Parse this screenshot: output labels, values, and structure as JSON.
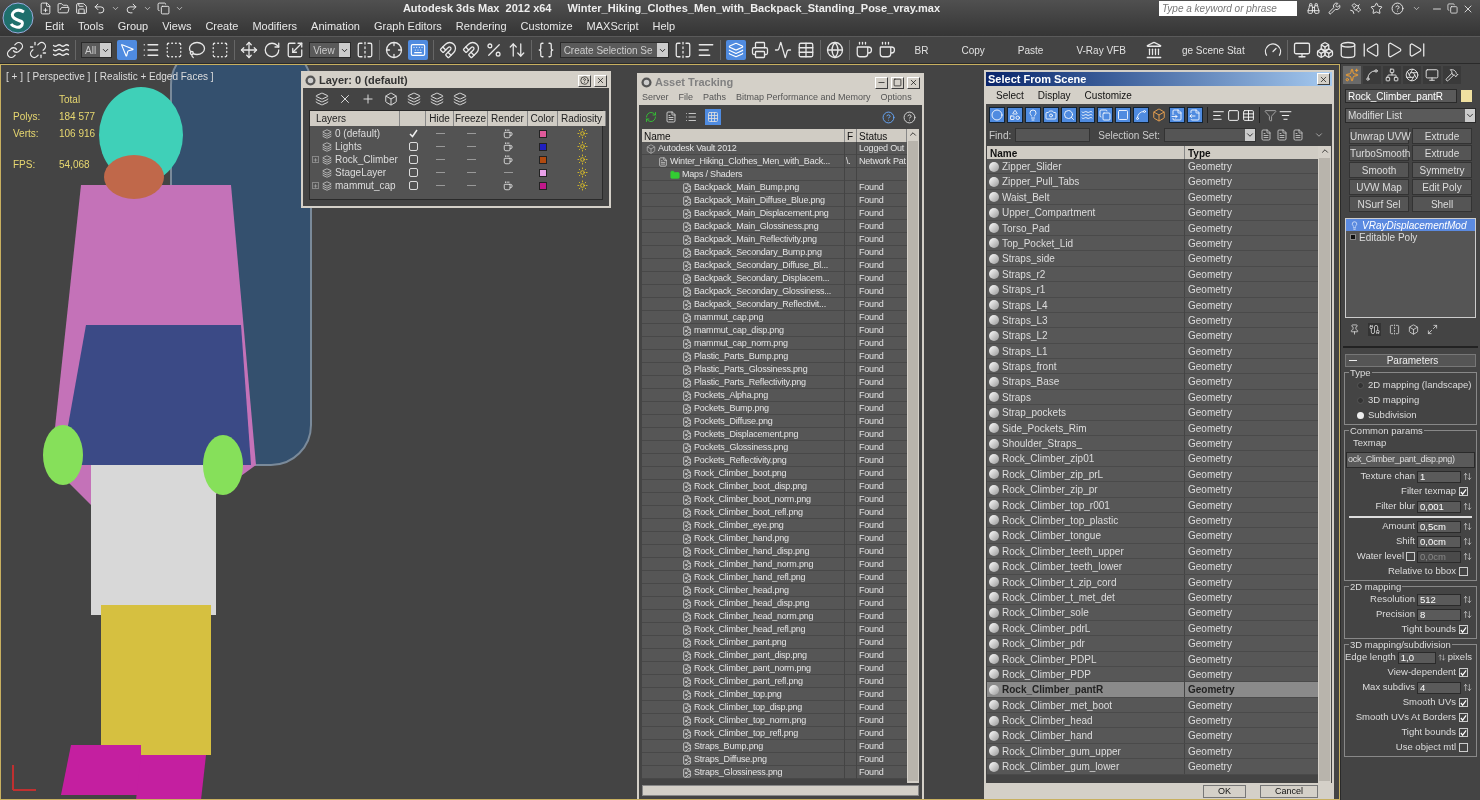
{
  "title_bar": {
    "app": "Autodesk 3ds Max  2012 x64",
    "file": "Winter_Hiking_Clothes_Men_with_Backpack_Standing_Pose_vray.max",
    "search_placeholder": "Type a keyword or phrase"
  },
  "menu": [
    "Edit",
    "Tools",
    "Group",
    "Views",
    "Create",
    "Modifiers",
    "Animation",
    "Graph Editors",
    "Rendering",
    "Customize",
    "MAXScript",
    "Help"
  ],
  "main_toolbar": [
    {
      "kind": "icon",
      "selected": false
    },
    {
      "kind": "icon",
      "selected": false
    },
    {
      "kind": "icon",
      "selected": false
    },
    {
      "kind": "separator"
    },
    {
      "kind": "dropdown",
      "value": "All"
    },
    {
      "kind": "icon",
      "selected": true
    },
    {
      "kind": "icon",
      "selected": false
    },
    {
      "kind": "icon",
      "selected": false
    },
    {
      "kind": "icon",
      "selected": false
    },
    {
      "kind": "icon",
      "selected": false
    },
    {
      "kind": "separator"
    },
    {
      "kind": "icon",
      "selected": false
    },
    {
      "kind": "icon",
      "selected": false
    },
    {
      "kind": "icon",
      "selected": false
    },
    {
      "kind": "dropdown",
      "value": "View"
    },
    {
      "kind": "icon",
      "selected": false
    },
    {
      "kind": "separator"
    },
    {
      "kind": "icon",
      "selected": false
    },
    {
      "kind": "icon",
      "selected": true
    },
    {
      "kind": "separator"
    },
    {
      "kind": "icon",
      "selected": false
    },
    {
      "kind": "icon",
      "selected": false
    },
    {
      "kind": "icon",
      "selected": false
    },
    {
      "kind": "icon",
      "selected": false
    },
    {
      "kind": "separator"
    },
    {
      "kind": "icon",
      "selected": false
    },
    {
      "kind": "dropdown",
      "value": "Create Selection Se"
    },
    {
      "kind": "icon",
      "selected": false
    },
    {
      "kind": "icon",
      "selected": false
    },
    {
      "kind": "separator"
    },
    {
      "kind": "icon",
      "selected": true
    },
    {
      "kind": "icon",
      "selected": false
    },
    {
      "kind": "icon",
      "selected": false
    },
    {
      "kind": "icon",
      "selected": false
    },
    {
      "kind": "separator"
    },
    {
      "kind": "icon",
      "selected": false
    },
    {
      "kind": "separator"
    },
    {
      "kind": "icon",
      "selected": false
    },
    {
      "kind": "icon",
      "selected": false
    },
    {
      "kind": "text",
      "label": "BR"
    },
    {
      "kind": "text",
      "label": "Copy"
    },
    {
      "kind": "text",
      "label": "Paste"
    },
    {
      "kind": "text",
      "label": "V-Ray VFB"
    },
    {
      "kind": "icon",
      "selected": false
    },
    {
      "kind": "text",
      "label": "ge Scene Stat"
    },
    {
      "kind": "icon",
      "selected": false
    },
    {
      "kind": "separator"
    },
    {
      "kind": "icon",
      "selected": false
    },
    {
      "kind": "icon",
      "selected": false
    },
    {
      "kind": "icon",
      "selected": false
    },
    {
      "kind": "icon",
      "selected": false
    },
    {
      "kind": "icon",
      "selected": false
    },
    {
      "kind": "icon",
      "selected": false
    }
  ],
  "viewport": {
    "labels": [
      "[ + ]",
      "[ Perspective ]",
      "[ Realistic + Edged Faces ]"
    ],
    "stats": {
      "heading": "Total",
      "rows": [
        {
          "label": "Polys:",
          "value": "184 577"
        },
        {
          "label": "Verts:",
          "value": "106 916"
        },
        {
          "label": "FPS:",
          "value": "54,068"
        }
      ]
    }
  },
  "layer_window": {
    "title": "Layer: 0 (default)",
    "columns": [
      "Layers",
      "Hide",
      "Freeze",
      "Render",
      "Color",
      "Radiosity"
    ],
    "layers": [
      {
        "name": "0 (default)",
        "current": true,
        "expandable": false,
        "render": true,
        "color": "#e05a9a"
      },
      {
        "name": "Lights",
        "current": false,
        "expandable": false,
        "render": true,
        "color": "#2020c0"
      },
      {
        "name": "Rock_Climber",
        "current": false,
        "expandable": true,
        "render": true,
        "color": "#b04a10"
      },
      {
        "name": "StageLayer",
        "current": false,
        "expandable": false,
        "render": false,
        "color": "#e8a0e8"
      },
      {
        "name": "mammut_cap",
        "current": false,
        "expandable": true,
        "render": true,
        "color": "#c0188a"
      }
    ]
  },
  "asset_tracking": {
    "title": "Asset Tracking",
    "menu": [
      "Server",
      "File",
      "Paths",
      "Bitmap Performance and Memory",
      "Options"
    ],
    "columns": [
      "Name",
      "F",
      "Status"
    ],
    "tree": [
      {
        "kind": "vault",
        "name": "Autodesk Vault 2012",
        "status": "Logged Out",
        "children": [
          {
            "kind": "scene-file",
            "name": "Winter_Hiking_Clothes_Men_with_Back...",
            "flag": "\\.",
            "status": "Network Pat",
            "children": [
              {
                "kind": "folder",
                "name": "Maps / Shaders",
                "children": [
                  {
                    "kind": "bitmap",
                    "name": "Backpack_Main_Bump.png",
                    "status": "Found"
                  },
                  {
                    "kind": "bitmap",
                    "name": "Backpack_Main_Diffuse_Blue.png",
                    "status": "Found"
                  },
                  {
                    "kind": "bitmap",
                    "name": "Backpack_Main_Displacement.png",
                    "status": "Found"
                  },
                  {
                    "kind": "bitmap",
                    "name": "Backpack_Main_Glossiness.png",
                    "status": "Found"
                  },
                  {
                    "kind": "bitmap",
                    "name": "Backpack_Main_Reflectivity.png",
                    "status": "Found"
                  },
                  {
                    "kind": "bitmap",
                    "name": "Backpack_Secondary_Bump.png",
                    "status": "Found"
                  },
                  {
                    "kind": "bitmap",
                    "name": "Backpack_Secondary_Diffuse_Bl...",
                    "status": "Found"
                  },
                  {
                    "kind": "bitmap",
                    "name": "Backpack_Secondary_Displacem...",
                    "status": "Found"
                  },
                  {
                    "kind": "bitmap",
                    "name": "Backpack_Secondary_Glossiness...",
                    "status": "Found"
                  },
                  {
                    "kind": "bitmap",
                    "name": "Backpack_Secondary_Reflectivit...",
                    "status": "Found"
                  },
                  {
                    "kind": "bitmap",
                    "name": "mammut_cap.png",
                    "status": "Found"
                  },
                  {
                    "kind": "bitmap",
                    "name": "mammut_cap_disp.png",
                    "status": "Found"
                  },
                  {
                    "kind": "bitmap",
                    "name": "mammut_cap_norm.png",
                    "status": "Found"
                  },
                  {
                    "kind": "bitmap",
                    "name": "Plastic_Parts_Bump.png",
                    "status": "Found"
                  },
                  {
                    "kind": "bitmap",
                    "name": "Plastic_Parts_Glossiness.png",
                    "status": "Found"
                  },
                  {
                    "kind": "bitmap",
                    "name": "Plastic_Parts_Reflectivity.png",
                    "status": "Found"
                  },
                  {
                    "kind": "bitmap",
                    "name": "Pockets_Alpha.png",
                    "status": "Found"
                  },
                  {
                    "kind": "bitmap",
                    "name": "Pockets_Bump.png",
                    "status": "Found"
                  },
                  {
                    "kind": "bitmap",
                    "name": "Pockets_Diffuse.png",
                    "status": "Found"
                  },
                  {
                    "kind": "bitmap",
                    "name": "Pockets_Displacement.png",
                    "status": "Found"
                  },
                  {
                    "kind": "bitmap",
                    "name": "Pockets_Glossiness.png",
                    "status": "Found"
                  },
                  {
                    "kind": "bitmap",
                    "name": "Pockets_Reflectivity.png",
                    "status": "Found"
                  },
                  {
                    "kind": "bitmap",
                    "name": "Rock_Climber_boot.png",
                    "status": "Found"
                  },
                  {
                    "kind": "bitmap",
                    "name": "Rock_Climber_boot_disp.png",
                    "status": "Found"
                  },
                  {
                    "kind": "bitmap",
                    "name": "Rock_Climber_boot_norm.png",
                    "status": "Found"
                  },
                  {
                    "kind": "bitmap",
                    "name": "Rock_Climber_boot_refl.png",
                    "status": "Found"
                  },
                  {
                    "kind": "bitmap",
                    "name": "Rock_Climber_eye.png",
                    "status": "Found"
                  },
                  {
                    "kind": "bitmap",
                    "name": "Rock_Climber_hand.png",
                    "status": "Found"
                  },
                  {
                    "kind": "bitmap",
                    "name": "Rock_Climber_hand_disp.png",
                    "status": "Found"
                  },
                  {
                    "kind": "bitmap",
                    "name": "Rock_Climber_hand_norm.png",
                    "status": "Found"
                  },
                  {
                    "kind": "bitmap",
                    "name": "Rock_Climber_hand_refl.png",
                    "status": "Found"
                  },
                  {
                    "kind": "bitmap",
                    "name": "Rock_Climber_head.png",
                    "status": "Found"
                  },
                  {
                    "kind": "bitmap",
                    "name": "Rock_Climber_head_disp.png",
                    "status": "Found"
                  },
                  {
                    "kind": "bitmap",
                    "name": "Rock_Climber_head_norm.png",
                    "status": "Found"
                  },
                  {
                    "kind": "bitmap",
                    "name": "Rock_Climber_head_refl.png",
                    "status": "Found"
                  },
                  {
                    "kind": "bitmap",
                    "name": "Rock_Climber_pant.png",
                    "status": "Found"
                  },
                  {
                    "kind": "bitmap",
                    "name": "Rock_Climber_pant_disp.png",
                    "status": "Found"
                  },
                  {
                    "kind": "bitmap",
                    "name": "Rock_Climber_pant_norm.png",
                    "status": "Found"
                  },
                  {
                    "kind": "bitmap",
                    "name": "Rock_Climber_pant_refl.png",
                    "status": "Found"
                  },
                  {
                    "kind": "bitmap",
                    "name": "Rock_Climber_top.png",
                    "status": "Found"
                  },
                  {
                    "kind": "bitmap",
                    "name": "Rock_Climber_top_disp.png",
                    "status": "Found"
                  },
                  {
                    "kind": "bitmap",
                    "name": "Rock_Climber_top_norm.png",
                    "status": "Found"
                  },
                  {
                    "kind": "bitmap",
                    "name": "Rock_Climber_top_refl.png",
                    "status": "Found"
                  },
                  {
                    "kind": "bitmap",
                    "name": "Straps_Bump.png",
                    "status": "Found"
                  },
                  {
                    "kind": "bitmap",
                    "name": "Straps_Diffuse.png",
                    "status": "Found"
                  },
                  {
                    "kind": "bitmap",
                    "name": "Straps_Glossiness.png",
                    "status": "Found"
                  }
                ]
              }
            ]
          }
        ]
      }
    ]
  },
  "select_from_scene": {
    "title": "Select From Scene",
    "menu": [
      "Select",
      "Display",
      "Customize"
    ],
    "filters": [
      {
        "selected": true
      },
      {
        "selected": true
      },
      {
        "selected": true
      },
      {
        "selected": true
      },
      {
        "selected": true
      },
      {
        "selected": true
      },
      {
        "selected": true
      },
      {
        "selected": true
      },
      {
        "selected": true
      },
      {
        "selected": false
      },
      {
        "selected": true
      },
      {
        "selected": true
      }
    ],
    "find_label": "Find:",
    "selection_set_label": "Selection Set:",
    "columns": [
      "Name",
      "Type"
    ],
    "rows": [
      {
        "name": "Zipper_Slider",
        "type": "Geometry",
        "selected": false
      },
      {
        "name": "Zipper_Pull_Tabs",
        "type": "Geometry",
        "selected": false
      },
      {
        "name": "Waist_Belt",
        "type": "Geometry",
        "selected": false
      },
      {
        "name": "Upper_Compartment",
        "type": "Geometry",
        "selected": false
      },
      {
        "name": "Torso_Pad",
        "type": "Geometry",
        "selected": false
      },
      {
        "name": "Top_Pocket_Lid",
        "type": "Geometry",
        "selected": false
      },
      {
        "name": "Straps_side",
        "type": "Geometry",
        "selected": false
      },
      {
        "name": "Straps_r2",
        "type": "Geometry",
        "selected": false
      },
      {
        "name": "Straps_r1",
        "type": "Geometry",
        "selected": false
      },
      {
        "name": "Straps_L4",
        "type": "Geometry",
        "selected": false
      },
      {
        "name": "Straps_L3",
        "type": "Geometry",
        "selected": false
      },
      {
        "name": "Straps_L2",
        "type": "Geometry",
        "selected": false
      },
      {
        "name": "Straps_L1",
        "type": "Geometry",
        "selected": false
      },
      {
        "name": "Straps_front",
        "type": "Geometry",
        "selected": false
      },
      {
        "name": "Straps_Base",
        "type": "Geometry",
        "selected": false
      },
      {
        "name": "Straps",
        "type": "Geometry",
        "selected": false
      },
      {
        "name": "Strap_pockets",
        "type": "Geometry",
        "selected": false
      },
      {
        "name": "Side_Pockets_Rim",
        "type": "Geometry",
        "selected": false
      },
      {
        "name": "Shoulder_Straps_",
        "type": "Geometry",
        "selected": false
      },
      {
        "name": "Rock_Climber_zip01",
        "type": "Geometry",
        "selected": false
      },
      {
        "name": "Rock_Climber_zip_prL",
        "type": "Geometry",
        "selected": false
      },
      {
        "name": "Rock_Climber_zip_pr",
        "type": "Geometry",
        "selected": false
      },
      {
        "name": "Rock_Climber_top_r001",
        "type": "Geometry",
        "selected": false
      },
      {
        "name": "Rock_Climber_top_plastic",
        "type": "Geometry",
        "selected": false
      },
      {
        "name": "Rock_Climber_tongue",
        "type": "Geometry",
        "selected": false
      },
      {
        "name": "Rock_Climber_teeth_upper",
        "type": "Geometry",
        "selected": false
      },
      {
        "name": "Rock_Climber_teeth_lower",
        "type": "Geometry",
        "selected": false
      },
      {
        "name": "Rock_Climber_t_zip_cord",
        "type": "Geometry",
        "selected": false
      },
      {
        "name": "Rock_Climber_t_met_det",
        "type": "Geometry",
        "selected": false
      },
      {
        "name": "Rock_Climber_sole",
        "type": "Geometry",
        "selected": false
      },
      {
        "name": "Rock_Climber_pdrL",
        "type": "Geometry",
        "selected": false
      },
      {
        "name": "Rock_Climber_pdr",
        "type": "Geometry",
        "selected": false
      },
      {
        "name": "Rock_Climber_PDPL",
        "type": "Geometry",
        "selected": false
      },
      {
        "name": "Rock_Climber_PDP",
        "type": "Geometry",
        "selected": false
      },
      {
        "name": "Rock_Climber_pantR",
        "type": "Geometry",
        "selected": true
      },
      {
        "name": "Rock_Climber_met_boot",
        "type": "Geometry",
        "selected": false
      },
      {
        "name": "Rock_Climber_head",
        "type": "Geometry",
        "selected": false
      },
      {
        "name": "Rock_Climber_hand",
        "type": "Geometry",
        "selected": false
      },
      {
        "name": "Rock_Climber_gum_upper",
        "type": "Geometry",
        "selected": false
      },
      {
        "name": "Rock_Climber_gum_lower",
        "type": "Geometry",
        "selected": false
      }
    ],
    "buttons": [
      "OK",
      "Cancel"
    ]
  },
  "command_panel": {
    "tabs": [
      {
        "selected": true
      },
      {
        "selected": false
      },
      {
        "selected": false
      },
      {
        "selected": false
      },
      {
        "selected": false
      },
      {
        "selected": false
      }
    ],
    "object_name": "Rock_Climber_pantR",
    "modifier_list": "Modifier List",
    "modifier_buttons": [
      "Unwrap UVW",
      "Extrude",
      "TurboSmooth",
      "Extrude",
      "Smooth",
      "Symmetry",
      "UVW Map",
      "Edit Poly",
      "NSurf Sel",
      "Shell"
    ],
    "stack": [
      {
        "label": "VRayDisplacementMod",
        "kind": "modifier",
        "selected": true
      },
      {
        "label": "Editable Poly",
        "kind": "base",
        "selected": false
      }
    ],
    "parameters": {
      "title": "Parameters",
      "groups": [
        {
          "title": "Type",
          "controls": [
            {
              "kind": "radio",
              "label": "2D mapping (landscape)",
              "selected": false
            },
            {
              "kind": "radio",
              "label": "3D mapping",
              "selected": false
            },
            {
              "kind": "radio",
              "label": "Subdivision",
              "selected": true
            }
          ]
        },
        {
          "title": "Common params",
          "controls": [
            {
              "kind": "caption",
              "label": "Texmap"
            },
            {
              "kind": "map-button",
              "label": "ock_Climber_pant_disp.png)"
            },
            {
              "kind": "spinner",
              "label": "Texture chan",
              "value": "1"
            },
            {
              "kind": "checkbox",
              "label": "Filter texmap",
              "checked": true
            },
            {
              "kind": "spinner",
              "label": "Filter blur",
              "value": "0,001"
            },
            {
              "kind": "divider"
            },
            {
              "kind": "spinner",
              "label": "Amount",
              "value": "0,5cm"
            },
            {
              "kind": "spinner",
              "label": "Shift",
              "value": "0,0cm"
            },
            {
              "kind": "check-spinner",
              "label": "Water level",
              "checked": false,
              "value": "0,0cm",
              "disabled": true
            },
            {
              "kind": "checkbox",
              "label": "Relative to bbox",
              "checked": false
            }
          ]
        },
        {
          "title": "2D mapping",
          "controls": [
            {
              "kind": "spinner",
              "label": "Resolution",
              "value": "512"
            },
            {
              "kind": "spinner",
              "label": "Precision",
              "value": "8"
            },
            {
              "kind": "checkbox",
              "label": "Tight bounds",
              "checked": true
            }
          ]
        },
        {
          "title": "3D mapping/subdivision",
          "controls": [
            {
              "kind": "spinner",
              "label": "Edge length",
              "value": "1,0",
              "suffix": "pixels"
            },
            {
              "kind": "checkbox",
              "label": "View-dependent",
              "checked": true
            },
            {
              "kind": "spinner",
              "label": "Max subdivs",
              "value": "4"
            },
            {
              "kind": "checkbox",
              "label": "Smooth UVs",
              "checked": true
            },
            {
              "kind": "checkbox",
              "label": "Smooth UVs At Borders",
              "checked": true
            },
            {
              "kind": "checkbox",
              "label": "Tight bounds",
              "checked": true
            },
            {
              "kind": "checkbox",
              "label": "Use object mtl",
              "checked": false
            }
          ]
        }
      ]
    }
  }
}
